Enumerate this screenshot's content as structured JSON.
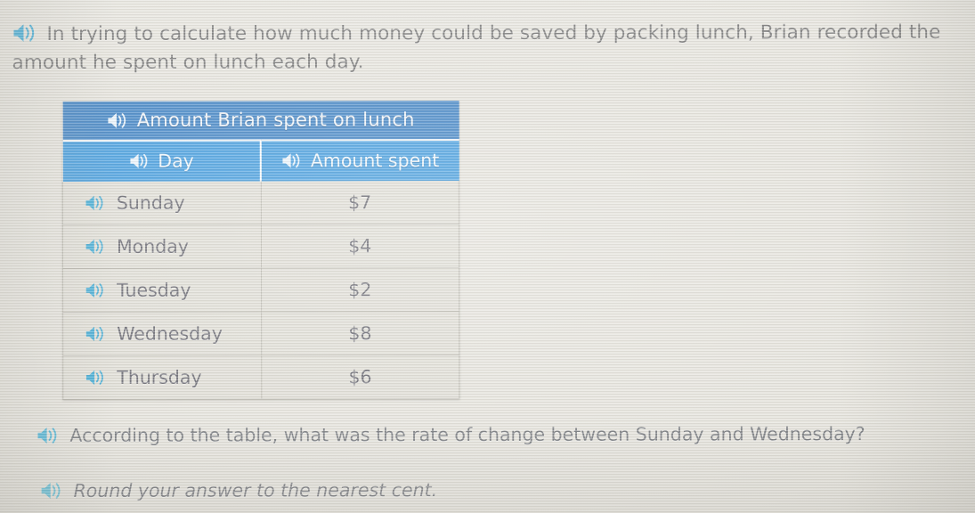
{
  "colors": {
    "background": "#e4e2db",
    "table_title_blue": "#3c81c4",
    "table_header_blue": "#3e9ade",
    "row_background": "#dedcd4",
    "body_text": "#6d6d6d",
    "speaker_icon_blue": "#3aa8d4",
    "speaker_icon_light": "#eaf3fb"
  },
  "prompt": {
    "speaker_icon": "speaker-icon",
    "text": "In trying to calculate how much money could be saved by packing lunch, Brian recorded the amount he spent on lunch each day."
  },
  "table": {
    "title": "Amount Brian spent on lunch",
    "title_speaker_icon": "speaker-icon",
    "columns": [
      {
        "label": "Day",
        "speaker_icon": "speaker-icon"
      },
      {
        "label": "Amount spent",
        "speaker_icon": "speaker-icon"
      }
    ],
    "rows": [
      {
        "day": "Sunday",
        "amount": "$7",
        "speaker_icon": "speaker-icon"
      },
      {
        "day": "Monday",
        "amount": "$4",
        "speaker_icon": "speaker-icon"
      },
      {
        "day": "Tuesday",
        "amount": "$2",
        "speaker_icon": "speaker-icon"
      },
      {
        "day": "Wednesday",
        "amount": "$8",
        "speaker_icon": "speaker-icon"
      },
      {
        "day": "Thursday",
        "amount": "$6",
        "speaker_icon": "speaker-icon"
      }
    ]
  },
  "questions": [
    {
      "speaker_icon": "speaker-icon",
      "text": "According to the table, what was the rate of change between Sunday and Wednesday?"
    },
    {
      "speaker_icon": "speaker-icon",
      "text": "Round your answer to the nearest cent."
    }
  ],
  "chart_data": {
    "type": "table",
    "title": "Amount Brian spent on lunch",
    "columns": [
      "Day",
      "Amount spent"
    ],
    "categories": [
      "Sunday",
      "Monday",
      "Tuesday",
      "Wednesday",
      "Thursday"
    ],
    "values": [
      7,
      4,
      2,
      8,
      6
    ],
    "unit": "$",
    "rows": [
      [
        "Sunday",
        "$7"
      ],
      [
        "Monday",
        "$4"
      ],
      [
        "Tuesday",
        "$2"
      ],
      [
        "Wednesday",
        "$8"
      ],
      [
        "Thursday",
        "$6"
      ]
    ]
  }
}
